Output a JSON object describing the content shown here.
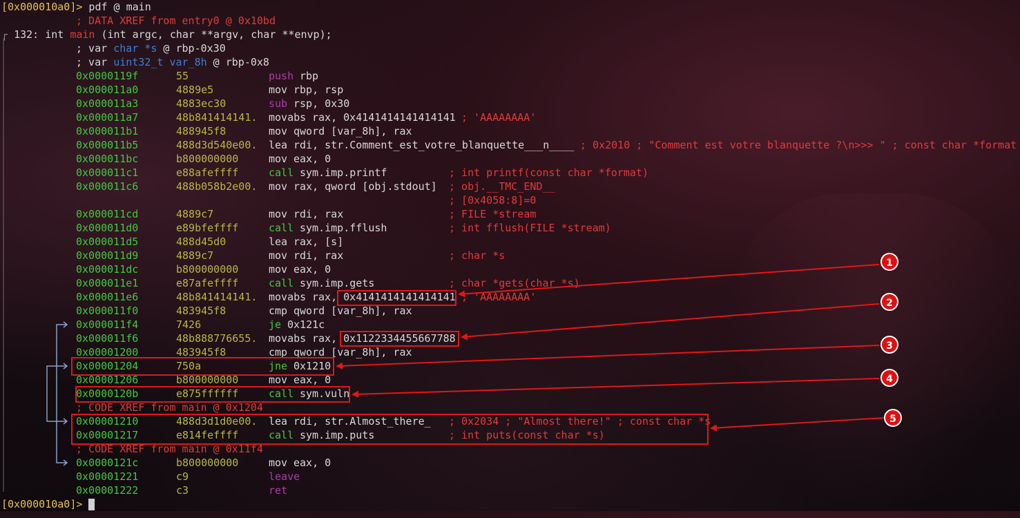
{
  "prompt": {
    "address": "[0x000010a0]>",
    "command": " pdf @ main"
  },
  "header": {
    "xref_entry": "; DATA XREF from entry0 @ 0x10bd",
    "func_prefix": "132: ",
    "func_type": "int ",
    "func_name": "main",
    "func_sig": " (int argc, char **argv, char **envp);",
    "var1_prefix": "; var ",
    "var1_type": "char *s",
    "var1_rest": " @ rbp-0x30",
    "var2_type": "uint32_t var_8h",
    "var2_rest": " @ rbp-0x8"
  },
  "rows": [
    {
      "addr": "0x0000119f",
      "bytes": "55",
      "mnem": "push",
      "ops": "rbp",
      "comment": ""
    },
    {
      "addr": "0x000011a0",
      "bytes": "4889e5",
      "mnem": "mov",
      "ops": "rbp, rsp",
      "comment": ""
    },
    {
      "addr": "0x000011a3",
      "bytes": "4883ec30",
      "mnem": "sub",
      "ops": "rsp, 0x30",
      "comment": ""
    },
    {
      "addr": "0x000011a7",
      "bytes": "48b841414141.",
      "mnem": "movabs",
      "ops": "rax, 0x4141414141414141",
      "comment": "; 'AAAAAAAA'"
    },
    {
      "addr": "0x000011b1",
      "bytes": "488945f8",
      "mnem": "mov",
      "ops": "qword [var_8h], rax",
      "comment": ""
    },
    {
      "addr": "0x000011b5",
      "bytes": "488d3d540e00.",
      "mnem": "lea",
      "ops": "rdi, str.Comment_est_votre_blanquette___n____",
      "comment": "; 0x2010 ; \"Comment est votre blanquette ?\\n>>> \" ; const char *format"
    },
    {
      "addr": "0x000011bc",
      "bytes": "b800000000",
      "mnem": "mov",
      "ops": "eax, 0",
      "comment": ""
    },
    {
      "addr": "0x000011c1",
      "bytes": "e88afeffff",
      "mnem": "call",
      "ops": "sym.imp.printf",
      "comment": "; int printf(const char *format)"
    },
    {
      "addr": "0x000011c6",
      "bytes": "488b058b2e00.",
      "mnem": "mov",
      "ops": "rax, qword [obj.stdout]",
      "comment": "; obj.__TMC_END__"
    },
    {
      "addr": "",
      "bytes": "",
      "mnem": "",
      "ops": "",
      "comment": "; [0x4058:8]=0"
    },
    {
      "addr": "0x000011cd",
      "bytes": "4889c7",
      "mnem": "mov",
      "ops": "rdi, rax",
      "comment": "; FILE *stream"
    },
    {
      "addr": "0x000011d0",
      "bytes": "e89bfeffff",
      "mnem": "call",
      "ops": "sym.imp.fflush",
      "comment": "; int fflush(FILE *stream)"
    },
    {
      "addr": "0x000011d5",
      "bytes": "488d45d0",
      "mnem": "lea",
      "ops": "rax, [s]",
      "comment": ""
    },
    {
      "addr": "0x000011d9",
      "bytes": "4889c7",
      "mnem": "mov",
      "ops": "rdi, rax",
      "comment": "; char *s"
    },
    {
      "addr": "0x000011dc",
      "bytes": "b800000000",
      "mnem": "mov",
      "ops": "eax, 0",
      "comment": ""
    },
    {
      "addr": "0x000011e1",
      "bytes": "e87afeffff",
      "mnem": "call",
      "ops": "sym.imp.gets",
      "comment": "; char *gets(char *s)"
    },
    {
      "addr": "0x000011e6",
      "bytes": "48b841414141.",
      "mnem": "movabs",
      "ops": "rax, 0x4141414141414141",
      "comment": "; 'AAAAAAAA'"
    },
    {
      "addr": "0x000011f0",
      "bytes": "483945f8",
      "mnem": "cmp",
      "ops": "qword [var_8h], rax",
      "comment": ""
    },
    {
      "addr": "0x000011f4",
      "bytes": "7426",
      "mnem": "je",
      "ops": "0x121c",
      "comment": ""
    },
    {
      "addr": "0x000011f6",
      "bytes": "48b888776655.",
      "mnem": "movabs",
      "ops": "rax, 0x1122334455667788",
      "comment": ""
    },
    {
      "addr": "0x00001200",
      "bytes": "483945f8",
      "mnem": "cmp",
      "ops": "qword [var_8h], rax",
      "comment": ""
    },
    {
      "addr": "0x00001204",
      "bytes": "750a",
      "mnem": "jne",
      "ops": "0x1210",
      "comment": ""
    },
    {
      "addr": "0x00001206",
      "bytes": "b800000000",
      "mnem": "mov",
      "ops": "eax, 0",
      "comment": ""
    },
    {
      "addr": "0x0000120b",
      "bytes": "e875ffffff",
      "mnem": "call",
      "ops": "sym.vuln",
      "comment": ""
    },
    {
      "addr": "",
      "bytes": "",
      "mnem": "",
      "ops": "",
      "comment": "; CODE XREF from main @ 0x1204"
    },
    {
      "addr": "0x00001210",
      "bytes": "488d3d1d0e00.",
      "mnem": "lea",
      "ops": "rdi, str.Almost_there_",
      "comment": "; 0x2034 ; \"Almost there!\" ; const char *s"
    },
    {
      "addr": "0x00001217",
      "bytes": "e814feffff",
      "mnem": "call",
      "ops": "sym.imp.puts",
      "comment": "; int puts(const char *s)"
    },
    {
      "addr": "",
      "bytes": "",
      "mnem": "",
      "ops": "",
      "comment": "; CODE XREF from main @ 0x11f4"
    },
    {
      "addr": "0x0000121c",
      "bytes": "b800000000",
      "mnem": "mov",
      "ops": "eax, 0",
      "comment": ""
    },
    {
      "addr": "0x00001221",
      "bytes": "c9",
      "mnem": "leave",
      "ops": "",
      "comment": ""
    },
    {
      "addr": "0x00001222",
      "bytes": "c3",
      "mnem": "ret",
      "ops": "",
      "comment": ""
    }
  ],
  "annotations": [
    "1",
    "2",
    "3",
    "4",
    "5"
  ],
  "final_prompt": "[0x000010a0]>",
  "colors": {
    "highlight_box": "#e01818",
    "address": "#3ec93e",
    "comment": "#e03a3a",
    "type": "#3d7fd6"
  }
}
